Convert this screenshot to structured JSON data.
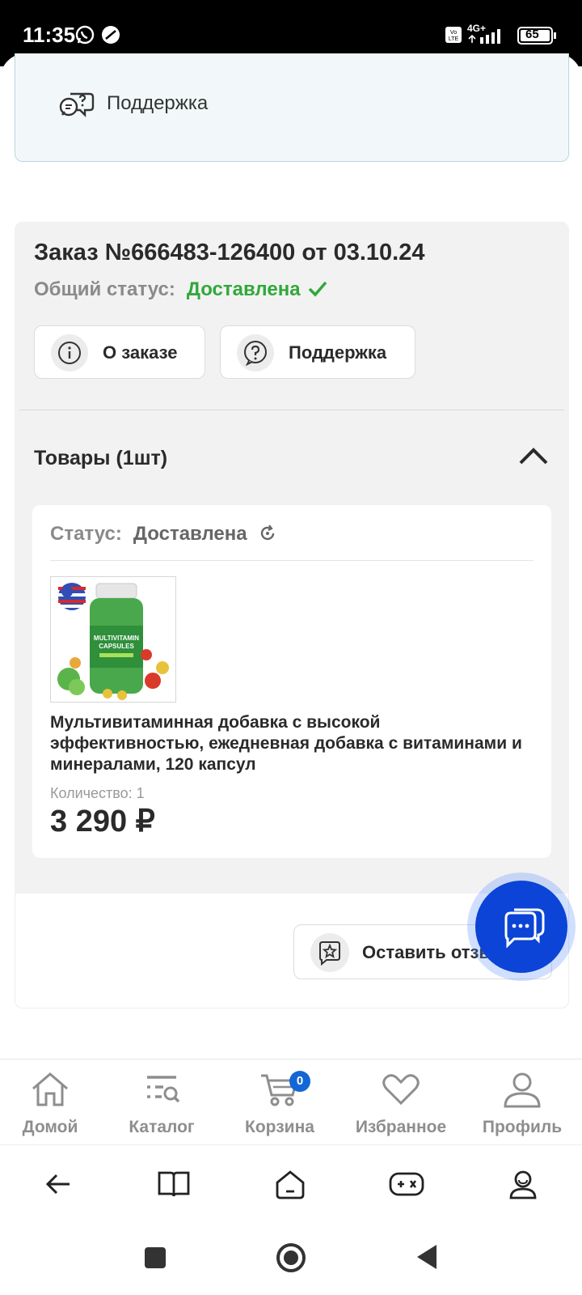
{
  "status_bar": {
    "time": "11:35",
    "network": "4G+",
    "battery": "65"
  },
  "support_card": {
    "label": "Поддержка"
  },
  "order": {
    "title": "Заказ №666483-126400 от 03.10.24",
    "status_label": "Общий статус:",
    "status_value": "Доставлена",
    "status_color": "#31a83a",
    "buttons": {
      "about": "О заказе",
      "support": "Поддержка"
    }
  },
  "goods": {
    "title": "Товары (1шт)",
    "item": {
      "status_label": "Статус:",
      "status_value": "Доставлена",
      "name": "Мультивитаминная добавка с высокой эффективностью, ежедневная добавка с витаминами и минералами, 120 капсул",
      "quantity": "Количество: 1",
      "price": "3 290 ₽",
      "image_text": [
        "MULTIVITAMIN",
        "CAPSULES"
      ]
    }
  },
  "review": {
    "button_label": "Оставить отзыв"
  },
  "bottom_nav": {
    "items": [
      {
        "label": "Домой",
        "icon": "home-icon"
      },
      {
        "label": "Каталог",
        "icon": "catalog-icon"
      },
      {
        "label": "Корзина",
        "icon": "cart-icon",
        "badge": "0"
      },
      {
        "label": "Избранное",
        "icon": "heart-icon"
      },
      {
        "label": "Профиль",
        "icon": "profile-icon"
      }
    ]
  },
  "colors": {
    "accent_blue": "#0b44d6",
    "badge_blue": "#1366d6"
  }
}
